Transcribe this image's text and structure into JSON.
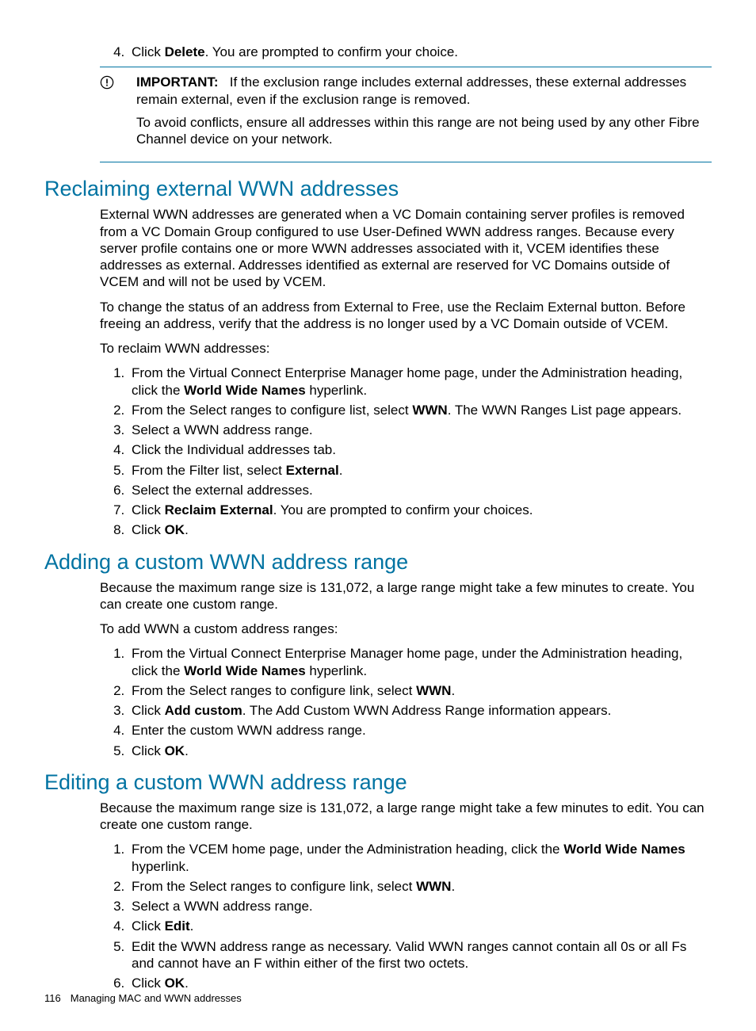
{
  "intro_step4": {
    "pre": "Click ",
    "bold": "Delete",
    "post": ". You are prompted to confirm your choice."
  },
  "important": {
    "label": "IMPORTANT:",
    "line1_post": "If the exclusion range includes external addresses, these external addresses remain external, even if the exclusion range is removed.",
    "line2": "To avoid conflicts, ensure all addresses within this range are not being used by any other Fibre Channel device on your network."
  },
  "sec1": {
    "heading": "Reclaiming external WWN addresses",
    "p1": "External WWN addresses are generated when a VC Domain containing server profiles is removed from a VC Domain Group configured to use User-Defined WWN address ranges. Because every server profile contains one or more WWN addresses associated with it, VCEM identifies these addresses as external. Addresses identified as external are reserved for VC Domains outside of VCEM and will not be used by VCEM.",
    "p2": "To change the status of an address from External to Free, use the Reclaim External button. Before freeing an address, verify that the address is no longer used by a VC Domain outside of VCEM.",
    "p3": "To reclaim WWN addresses:",
    "steps": {
      "s1_pre": "From the Virtual Connect Enterprise Manager home page, under the Administration heading, click the ",
      "s1_bold": "World Wide Names",
      "s1_post": " hyperlink.",
      "s2_pre": "From the Select ranges to configure list, select ",
      "s2_bold": "WWN",
      "s2_post": ". The WWN Ranges List page appears.",
      "s3": "Select a WWN address range.",
      "s4": "Click the Individual addresses tab.",
      "s5_pre": "From the Filter list, select ",
      "s5_bold": "External",
      "s5_post": ".",
      "s6": "Select the external addresses.",
      "s7_pre": "Click ",
      "s7_bold": "Reclaim External",
      "s7_post": ". You are prompted to confirm your choices.",
      "s8_pre": "Click ",
      "s8_bold": "OK",
      "s8_post": "."
    }
  },
  "sec2": {
    "heading": "Adding a custom WWN address range",
    "p1": "Because the maximum range size is 131,072, a large range might take a few minutes to create. You can create one custom range.",
    "p2": "To add WWN a custom address ranges:",
    "steps": {
      "s1_pre": "From the Virtual Connect Enterprise Manager home page, under the Administration heading, click the ",
      "s1_bold": "World Wide Names",
      "s1_post": " hyperlink.",
      "s2_pre": "From the Select ranges to configure link, select ",
      "s2_bold": "WWN",
      "s2_post": ".",
      "s3_pre": "Click ",
      "s3_bold": "Add custom",
      "s3_post": ". The Add Custom WWN Address Range information appears.",
      "s4": "Enter the custom WWN address range.",
      "s5_pre": "Click ",
      "s5_bold": "OK",
      "s5_post": "."
    }
  },
  "sec3": {
    "heading": "Editing a custom WWN address range",
    "p1": "Because the maximum range size is 131,072, a large range might take a few minutes to edit. You can create one custom range.",
    "steps": {
      "s1_pre": "From the VCEM home page, under the Administration heading, click the ",
      "s1_bold": "World Wide Names",
      "s1_post": " hyperlink.",
      "s2_pre": "From the Select ranges to configure link, select ",
      "s2_bold": "WWN",
      "s2_post": ".",
      "s3": "Select a WWN address range.",
      "s4_pre": "Click ",
      "s4_bold": "Edit",
      "s4_post": ".",
      "s5": "Edit the WWN address range as necessary. Valid WWN ranges cannot contain all 0s or all Fs and cannot have an F within either of the first two octets.",
      "s6_pre": "Click ",
      "s6_bold": "OK",
      "s6_post": "."
    }
  },
  "footer": {
    "page": "116",
    "title": "Managing MAC and WWN addresses"
  }
}
